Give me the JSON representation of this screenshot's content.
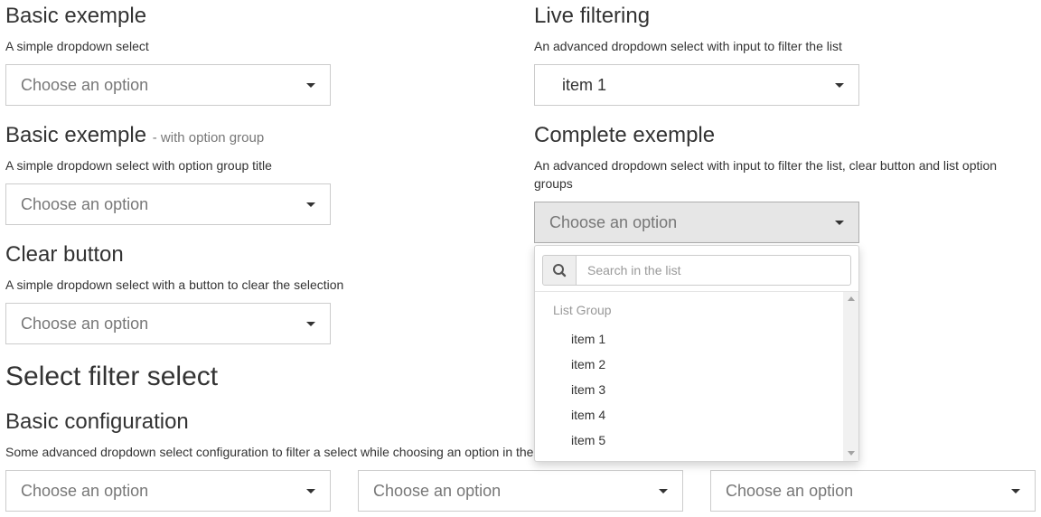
{
  "sections": {
    "basic": {
      "title": "Basic exemple",
      "description": "A simple dropdown select",
      "select_value": "Choose an option"
    },
    "basic_group": {
      "title": "Basic exemple",
      "title_small": "- with option group",
      "description": "A simple dropdown select with option group title",
      "select_value": "Choose an option"
    },
    "clear_button": {
      "title": "Clear button",
      "description": "A simple dropdown select with a button to clear the selection",
      "select_value": "Choose an option"
    },
    "live_filtering": {
      "title": "Live filtering",
      "description": "An advanced dropdown select with input to filter the list",
      "select_value": "item 1"
    },
    "complete": {
      "title": "Complete exemple",
      "description": "An advanced dropdown select with input to filter the list, clear button and list option groups",
      "select_value": "Choose an option",
      "dropdown": {
        "search_placeholder": "Search in the list",
        "group_title": "List Group",
        "items": [
          "item 1",
          "item 2",
          "item 3",
          "item 4",
          "item 5"
        ]
      }
    }
  },
  "filter_select": {
    "heading": "Select filter select",
    "subheading": "Basic configuration",
    "description": "Some advanced dropdown select configuration to filter a select while choosing an option in the",
    "selects": [
      "Choose an option",
      "Choose an option",
      "Choose an option"
    ]
  }
}
